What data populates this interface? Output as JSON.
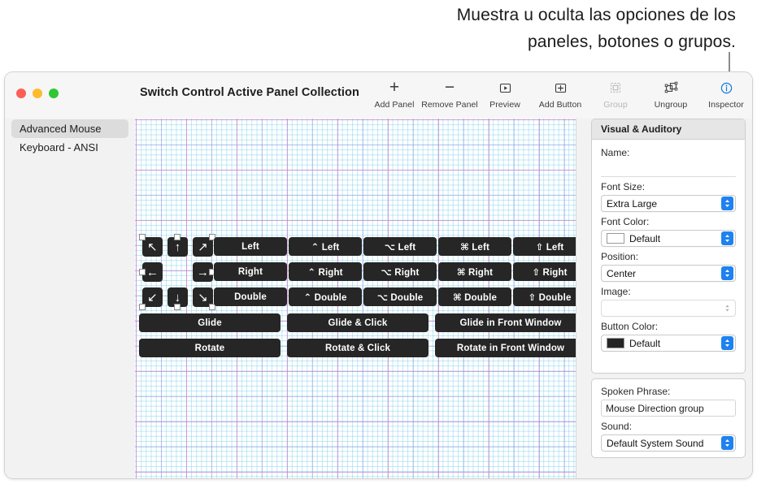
{
  "caption": {
    "line1": "Muestra u oculta las opciones de los",
    "line2": "paneles, botones o grupos."
  },
  "window": {
    "title": "Switch Control Active Panel Collection",
    "traffic_lights": [
      "close-red",
      "minimize-yellow",
      "zoom-green"
    ]
  },
  "toolbar": {
    "items": [
      {
        "label": "Add Panel",
        "icon": "plus-icon",
        "state": "enabled"
      },
      {
        "label": "Remove Panel",
        "icon": "minus-icon",
        "state": "enabled"
      },
      {
        "label": "Preview",
        "icon": "play-box-icon",
        "state": "enabled"
      },
      {
        "label": "Add Button",
        "icon": "plus-box-icon",
        "state": "enabled"
      },
      {
        "label": "Group",
        "icon": "group-icon",
        "state": "disabled"
      },
      {
        "label": "Ungroup",
        "icon": "ungroup-icon",
        "state": "enabled"
      },
      {
        "label": "Inspector",
        "icon": "info-circle-icon",
        "state": "active"
      }
    ]
  },
  "sidebar": {
    "items": [
      {
        "label": "Advanced Mouse",
        "selected": true
      },
      {
        "label": "Keyboard - ANSI",
        "selected": false
      }
    ]
  },
  "canvas": {
    "arrow_group": {
      "selected": true,
      "buttons": [
        {
          "glyph": "↖",
          "name": "arrow-up-left"
        },
        {
          "glyph": "↑",
          "name": "arrow-up"
        },
        {
          "glyph": "↗",
          "name": "arrow-up-right"
        },
        {
          "glyph": "←",
          "name": "arrow-left"
        },
        {
          "glyph": "→",
          "name": "arrow-right"
        },
        {
          "glyph": "↙",
          "name": "arrow-down-left"
        },
        {
          "glyph": "↓",
          "name": "arrow-down"
        },
        {
          "glyph": "↘",
          "name": "arrow-down-right"
        }
      ]
    },
    "click_buttons": [
      [
        "Left",
        "⌃ Left",
        "⌥ Left",
        "⌘ Left",
        "⇧ Left"
      ],
      [
        "Right",
        "⌃ Right",
        "⌥ Right",
        "⌘ Right",
        "⇧ Right"
      ],
      [
        "Double",
        "⌃ Double",
        "⌥ Double",
        "⌘ Double",
        "⇧ Double"
      ]
    ],
    "action_buttons": [
      [
        "Glide",
        "Glide & Click",
        "Glide in Front Window"
      ],
      [
        "Rotate",
        "Rotate & Click",
        "Rotate in Front Window"
      ]
    ]
  },
  "inspector": {
    "visual": {
      "title": "Visual & Auditory",
      "name_label": "Name:",
      "name_value": "",
      "font_size_label": "Font Size:",
      "font_size_value": "Extra Large",
      "font_color_label": "Font Color:",
      "font_color_value": "Default",
      "font_color_swatch": "#ffffff",
      "position_label": "Position:",
      "position_value": "Center",
      "image_label": "Image:",
      "image_value": "",
      "button_color_label": "Button Color:",
      "button_color_value": "Default",
      "button_color_swatch": "#262626"
    },
    "spoken": {
      "phrase_label": "Spoken Phrase:",
      "phrase_value": "Mouse Direction group",
      "sound_label": "Sound:",
      "sound_value": "Default System Sound"
    }
  },
  "colors": {
    "accent_blue": "#1e82f0",
    "button_dark": "#262626",
    "window_chrome": "#f2f2f2"
  }
}
